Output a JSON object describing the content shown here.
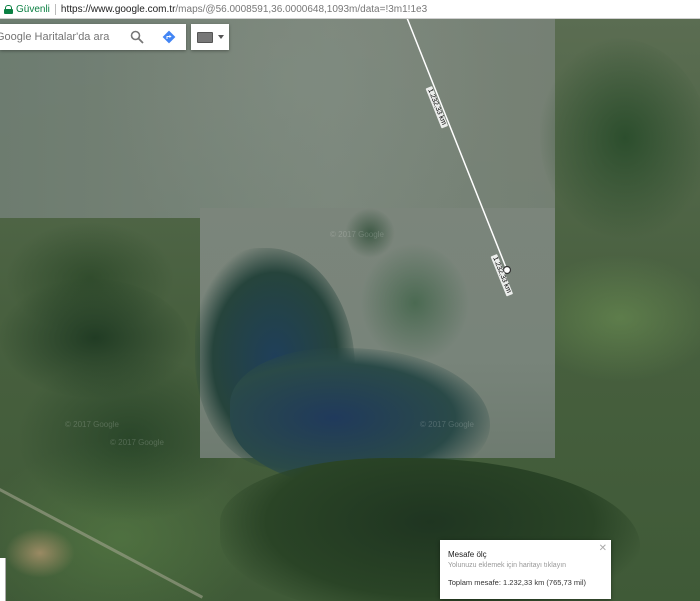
{
  "browser": {
    "security_label": "Güvenli",
    "url_host": "https://www.google.com.tr",
    "url_path": "/maps/@56.0008591,36.0000648,1093m/data=!3m1!1e3"
  },
  "search": {
    "placeholder": "Google Haritalar'da ara",
    "icon": "search-icon",
    "directions_icon": "directions-icon"
  },
  "input_tools": {
    "icon": "keyboard-icon"
  },
  "measure": {
    "segment_label_1": "1.232,33 km",
    "segment_label_2": "1.232,33 km"
  },
  "card": {
    "title": "Mesafe ölç",
    "hint": "Yolunuzu eklemek için haritayı tıklayın",
    "total_label": "Toplam mesafe:",
    "total_value": "1.232,33 km (765,73 mil)",
    "close_icon": "close-icon"
  },
  "watermark": "© 2017 Google",
  "colors": {
    "secure": "#0b8043",
    "directions": "#4285f4"
  }
}
